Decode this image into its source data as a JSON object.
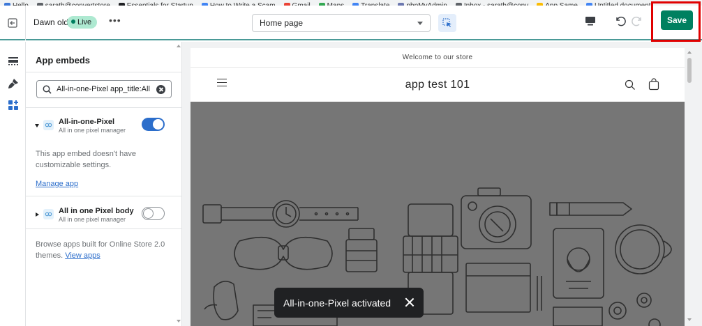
{
  "bookmarks": [
    {
      "label": "Hello",
      "color": "#3c78d8"
    },
    {
      "label": "sarath@convertstore",
      "color": "#5f6368"
    },
    {
      "label": "Essentials for Startup",
      "color": "#202124"
    },
    {
      "label": "How to Write a Scam",
      "color": "#4285f4"
    },
    {
      "label": "Gmail",
      "color": "#ea4335"
    },
    {
      "label": "Maps",
      "color": "#34a853"
    },
    {
      "label": "Translate",
      "color": "#4285f4"
    },
    {
      "label": "phpMyAdmin",
      "color": "#6c78af"
    },
    {
      "label": "Inbox - sarath@conv",
      "color": "#5f6368"
    },
    {
      "label": "App Same",
      "color": "#fbbc04"
    },
    {
      "label": "Untitled document",
      "color": "#4285f4"
    }
  ],
  "topbar": {
    "theme_name": "Dawn old",
    "live_label": "Live",
    "more_label": "•••",
    "page_select": "Home page",
    "save_label": "Save",
    "accent": "#008060",
    "highlight": "#e00000"
  },
  "sidebar": {
    "title": "App embeds",
    "search_value": "All-in-one-Pixel app_title:All",
    "embeds": [
      {
        "name": "All-in-one-Pixel",
        "sub": "All in one pixel manager",
        "enabled": true
      },
      {
        "name": "All in one Pixel body",
        "sub": "All in one pixel manager",
        "enabled": false
      }
    ],
    "no_settings_text": "This app embed doesn't have customizable settings.",
    "manage_link": "Manage app",
    "browse_text": "Browse apps built for Online Store 2.0 themes.",
    "view_apps_link": "View apps"
  },
  "store": {
    "announcement": "Welcome to our store",
    "name": "app test 101"
  },
  "toast": {
    "message": "All-in-one-Pixel activated"
  }
}
